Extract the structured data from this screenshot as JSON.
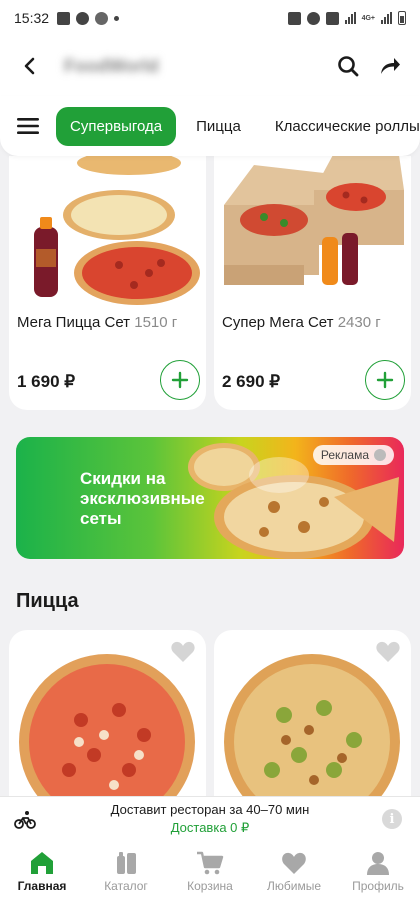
{
  "status_bar": {
    "time": "15:32",
    "network": "4G+"
  },
  "header": {
    "store_name": "FoodWorld"
  },
  "tabs": [
    {
      "label": "Супервыгода",
      "active": true
    },
    {
      "label": "Пицца",
      "active": false
    },
    {
      "label": "Классические роллы",
      "active": false
    }
  ],
  "products_top": [
    {
      "title": "Мега Пицца Сет",
      "weight": "1510 г",
      "price": "1 690 ₽"
    },
    {
      "title": "Супер Мега Сет",
      "weight": "2430 г",
      "price": "2 690 ₽"
    }
  ],
  "banner": {
    "text": "Скидки на эксклюзивные сеты",
    "badge": "Реклама"
  },
  "section": {
    "title": "Пицца"
  },
  "delivery": {
    "text": "Доставит ресторан за 40–70 мин",
    "cost": "Доставка 0 ₽",
    "info": "i"
  },
  "bottom_nav": [
    {
      "label": "Главная",
      "icon": "home-icon",
      "active": true
    },
    {
      "label": "Каталог",
      "icon": "catalog-icon",
      "active": false
    },
    {
      "label": "Корзина",
      "icon": "cart-icon",
      "active": false
    },
    {
      "label": "Любимые",
      "icon": "heart-icon",
      "active": false
    },
    {
      "label": "Профиль",
      "icon": "profile-icon",
      "active": false
    }
  ],
  "colors": {
    "accent": "#21a038",
    "background": "#f1f1f3",
    "inactive": "#9a9a9a"
  }
}
